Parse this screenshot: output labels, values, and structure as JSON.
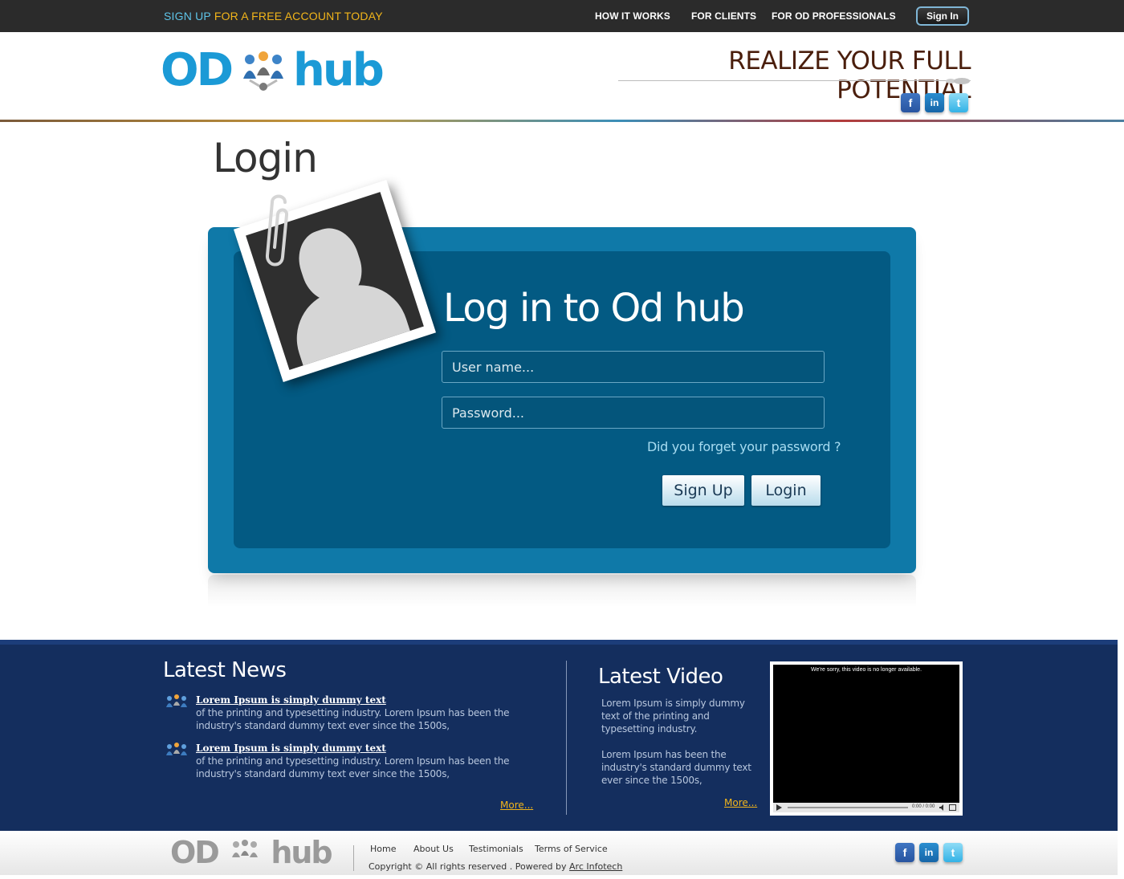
{
  "topbar": {
    "promo_sign_up": "SIGN UP",
    "promo_rest": "FOR A FREE ACCOUNT TODAY",
    "nav": [
      "HOW IT WORKS",
      "FOR CLIENTS",
      "FOR OD PROFESSIONALS"
    ],
    "sign_in": "Sign In"
  },
  "header": {
    "logo_left": "OD",
    "logo_right": "hub",
    "tagline": "REALIZE YOUR FULL POTENTIAL",
    "social": [
      "f",
      "in",
      "t"
    ]
  },
  "page": {
    "title": "Login"
  },
  "login": {
    "heading": "Log in to Od hub",
    "username_placeholder": "User name...",
    "password_placeholder": "Password...",
    "forgot": "Did you forget your password ?",
    "signup_label": "Sign Up",
    "login_label": "Login"
  },
  "news": {
    "title": "Latest News",
    "items": [
      {
        "headline": "Lorem Ipsum is simply dummy text",
        "body": "of the printing and typesetting industry. Lorem Ipsum has been the industry's standard dummy text ever since the 1500s,"
      },
      {
        "headline": "Lorem Ipsum is simply dummy text",
        "body": "of the printing and typesetting industry. Lorem Ipsum has been the industry's standard dummy text ever since the 1500s,"
      }
    ],
    "more": "More..."
  },
  "video": {
    "title": "Latest Video",
    "para1": "Lorem Ipsum is simply dummy text of the printing and typesetting industry.",
    "para2": "Lorem Ipsum has been the industry's standard dummy text ever since the 1500s,",
    "more": "More...",
    "unavailable": "We're sorry, this video is no longer available.",
    "time": "0:00 / 0:00"
  },
  "footer": {
    "logo_left": "OD",
    "logo_right": "hub",
    "links": [
      "Home",
      "About Us",
      "Testimonials",
      "Terms of Service"
    ],
    "copyright": "Copyright ©   All rights reserved . Powered by",
    "powered_by": "Arc Infotech"
  },
  "colors": {
    "topbar_bg": "#2b2b2b",
    "accent_blue": "#1b9ad6",
    "login_outer": "#0f79a8",
    "login_inner": "#035a83",
    "band_bg": "#142e5e",
    "promo_yellow": "#f2b51a"
  }
}
